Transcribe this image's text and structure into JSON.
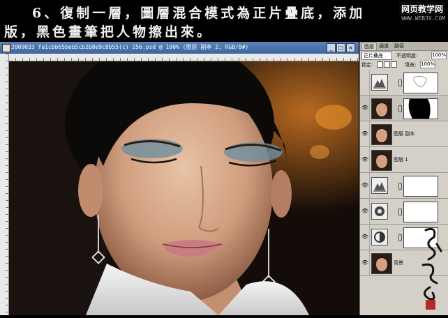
{
  "caption": {
    "line1": "6、復制一層，圖層混合模式為正片疊底，添加",
    "line2": "版，黑色畫筆把人物擦出來。"
  },
  "watermark": {
    "site": "网页教学网",
    "url": "WWW.WEB3X.COM"
  },
  "window": {
    "title": "2009033 fa1cbb65beb5cb2b8e9c8b55(c) 256.psd @ 100% (图层 副本 2, RGB/8#)",
    "buttons": [
      "_",
      "□",
      "×"
    ]
  },
  "panel": {
    "tabs": [
      "图层",
      "通道",
      "路径"
    ],
    "active_tab": "图层",
    "blend_mode": "正片叠底",
    "opacity_label": "不透明度:",
    "opacity": "100%",
    "lock_label": "锁定:",
    "fill_label": "填充:",
    "fill": "100%",
    "layers": [
      {
        "kind": "adjustment-mask",
        "name": "",
        "visible": false,
        "icon": "levels-icon"
      },
      {
        "kind": "photo-mask",
        "name": "",
        "visible": true
      },
      {
        "kind": "photo",
        "name": "图层 副本",
        "visible": true
      },
      {
        "kind": "photo",
        "name": "图层 1",
        "visible": true
      },
      {
        "kind": "adjustment-mask",
        "name": "",
        "visible": true,
        "icon": "levels-icon"
      },
      {
        "kind": "adjustment-mask",
        "name": "",
        "visible": true,
        "icon": "circle-adjust-icon"
      },
      {
        "kind": "adjustment-mask",
        "name": "",
        "visible": true,
        "icon": "channel-mixer-icon"
      },
      {
        "kind": "photo",
        "name": "背景",
        "visible": true
      }
    ]
  },
  "signature": "飛雅嬌人"
}
